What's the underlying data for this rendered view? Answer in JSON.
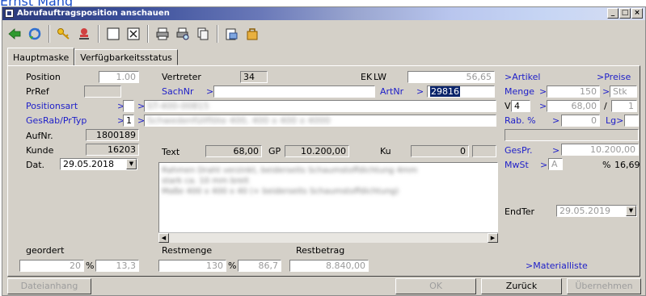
{
  "top_link": "Ernst Mang",
  "window": {
    "title": "Abrufauftragsposition anschauen",
    "controls": [
      "_",
      "□",
      "×"
    ]
  },
  "toolbar": {
    "icons": [
      "back-arrow-icon",
      "refresh-icon",
      "key-icon",
      "stamp-icon",
      "blank-page-icon",
      "grid-icon",
      "print-icon",
      "print-preview-icon",
      "copy-icon",
      "folder-icon",
      "bag-icon"
    ]
  },
  "tabs": [
    {
      "label": "Hauptmaske",
      "active": true
    },
    {
      "label": "Verfügbarkeitsstatus",
      "active": false
    }
  ],
  "form": {
    "position_label": "Position",
    "position_value": "1.00",
    "prref_label": "PrRef",
    "prref_value": "",
    "positionsart_label": "Positionsart",
    "positionsart_arrow": ">",
    "positionsart_value": "",
    "gesrab_label": "GesRab/PrTyp",
    "gesrab_arrow": ">",
    "gesrab_value": "1",
    "aufnr_label": "AufNr.",
    "aufnr_value": "1800189",
    "kunde_label": "Kunde",
    "kunde_value": "16203",
    "dat_label": "Dat.",
    "dat_value": "29.05.2018",
    "vertreter_label": "Vertreter",
    "vertreter_value": "34",
    "sachnr_label": "SachNr",
    "sachnr_arrow": ">",
    "sachnr_value": "",
    "ek_label": "EK",
    "lw_label": "LW",
    "ek_value": "56,65",
    "artnr_label": "ArtNr",
    "artnr_arrow": ">",
    "artnr_value": "29816",
    "arrow_small": ">",
    "text_label": "Text",
    "text_value": "68,00",
    "gp_label": "GP",
    "gp_value": "10.200,00",
    "ku_label": "Ku",
    "ku_value": "0",
    "artikel_link": ">Artikel",
    "preise_link": ">Preise",
    "menge_label": "Menge",
    "menge_arrow": ">",
    "menge_value": "150",
    "menge_unit_arrow": ">",
    "menge_unit": "Stk",
    "v_label": "V",
    "v_value": "4",
    "v_arrow": ">",
    "v_price": "68,00",
    "v_slash": "/",
    "v_per": "1",
    "rab_label": "Rab. %",
    "rab_arrow": ">",
    "rab_value": "0",
    "lg_label": "Lg>",
    "gespr_label": "GesPr.",
    "gespr_arrow": ">",
    "gespr_value": "10.200,00",
    "mwst_label": "MwSt",
    "mwst_arrow": ">",
    "mwst_code": "A",
    "mwst_pct_label": "%",
    "mwst_value": "16,69",
    "endter_label": "EndTer",
    "endter_value": "29.05.2019",
    "geordert_label": "geordert",
    "geordert_value": "20",
    "geordert_pct_label": "%",
    "geordert_pct": "13,3",
    "restmenge_label": "Restmenge",
    "restmenge_value": "130",
    "restmenge_pct_label": "%",
    "restmenge_pct": "86,7",
    "restbetrag_label": "Restbetrag",
    "restbetrag_value": "8.840,00",
    "materialliste_link": ">Materialliste"
  },
  "blurred": {
    "positionsart_desc": "ST-400-00815",
    "gesrab_desc": "Schwedenfüllflöte 400, 400 x 400 x 4000",
    "text_lines": [
      "Rahmen Draht verzinkt, beiderseits Schaumstoffdichtung 4mm",
      "stark ca. 10 mm breit",
      "Maße 400 x 400 x 40 (+ beiderseits Schaumstoffdichtung)"
    ]
  },
  "buttons": {
    "dateianhang": "Dateianhang",
    "ok": "OK",
    "zurueck": "Zurück",
    "uebernehmen": "Übernehmen"
  },
  "colors": {
    "window_bg": "#d4d0c8",
    "link_blue": "#1d1ec9",
    "selection": "#0a246a"
  }
}
